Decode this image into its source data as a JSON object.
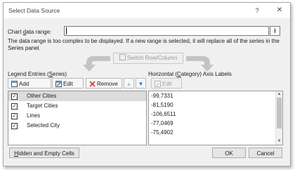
{
  "dialog": {
    "title": "Select Data Source",
    "help_glyph": "?",
    "close_glyph": "✕"
  },
  "chart_range": {
    "label": "Chart data range:",
    "value": "",
    "collapse_glyph": "⭱"
  },
  "note": "The data range is too complex to be displayed. If a new range is selected, it will replace all of the series in the Series panel.",
  "switch_button": {
    "label": "Switch Row/Column"
  },
  "legend": {
    "label": "Legend Entries (Series)",
    "add_label": "Add",
    "edit_label": "Edit",
    "remove_label": "Remove",
    "up_glyph": "▲",
    "down_glyph": "▼",
    "items": [
      {
        "label": "Other Cities",
        "checked": true
      },
      {
        "label": "Target Cities",
        "checked": true
      },
      {
        "label": "Lines",
        "checked": true
      },
      {
        "label": "Selected City",
        "checked": true
      }
    ]
  },
  "axis": {
    "label": "Horizontal (Category) Axis Labels",
    "edit_label": "Edit",
    "values": [
      "-99,7331",
      "-81,5190",
      "-106,6511",
      "-77,0469",
      "-75,4902"
    ]
  },
  "footer": {
    "hidden_cells_label": "Hidden and Empty Cells",
    "ok_label": "OK",
    "cancel_label": "Cancel"
  },
  "colors": {
    "accent": "#2b7cd3",
    "arrow_gray": "#c4c4c4",
    "selection": "#dcdcdc"
  }
}
